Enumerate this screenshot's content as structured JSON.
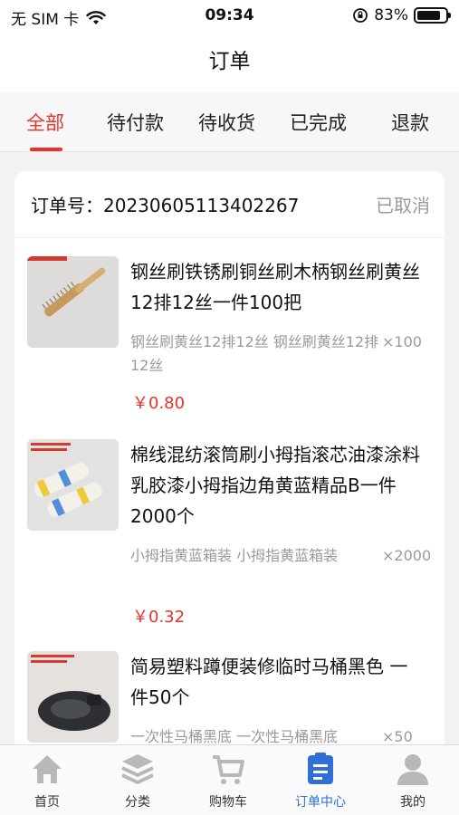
{
  "status_bar": {
    "carrier": "无 SIM 卡",
    "time": "09:34",
    "battery": "83%",
    "battery_level": 0.83
  },
  "nav": {
    "title": "订单"
  },
  "tabs": [
    "全部",
    "待付款",
    "待收货",
    "已完成",
    "退款"
  ],
  "active_tab": "全部",
  "order": {
    "number_label": "订单号：",
    "number": "20230605113402267",
    "status": "已取消",
    "items": [
      {
        "title": "钢丝刷铁锈刷铜丝刷木柄钢丝刷黄丝12排12丝一件100把",
        "spec": "钢丝刷黄丝12排12丝 钢丝刷黄丝12排12丝",
        "qty": "×100",
        "price": "￥0.80"
      },
      {
        "title": "棉线混纺滚筒刷小拇指滚芯油漆涂料乳胶漆小拇指边角黄蓝精品B一件2000个",
        "spec": "小拇指黄蓝箱装 小拇指黄蓝箱装",
        "qty": "×2000",
        "price": "￥0.32"
      },
      {
        "title": "简易塑料蹲便装修临时马桶黑色 一件50个",
        "spec": "一次性马桶黑底 一次性马桶黑底",
        "qty": "×50",
        "price": ""
      }
    ]
  },
  "tabbar": [
    {
      "label": "首页",
      "icon": "home-icon"
    },
    {
      "label": "分类",
      "icon": "layers-icon"
    },
    {
      "label": "购物车",
      "icon": "cart-icon"
    },
    {
      "label": "订单中心",
      "icon": "orders-icon"
    },
    {
      "label": "我的",
      "icon": "profile-icon"
    }
  ],
  "colors": {
    "accent": "#e8332a",
    "active_tab_blue": "#2f6fd6"
  }
}
